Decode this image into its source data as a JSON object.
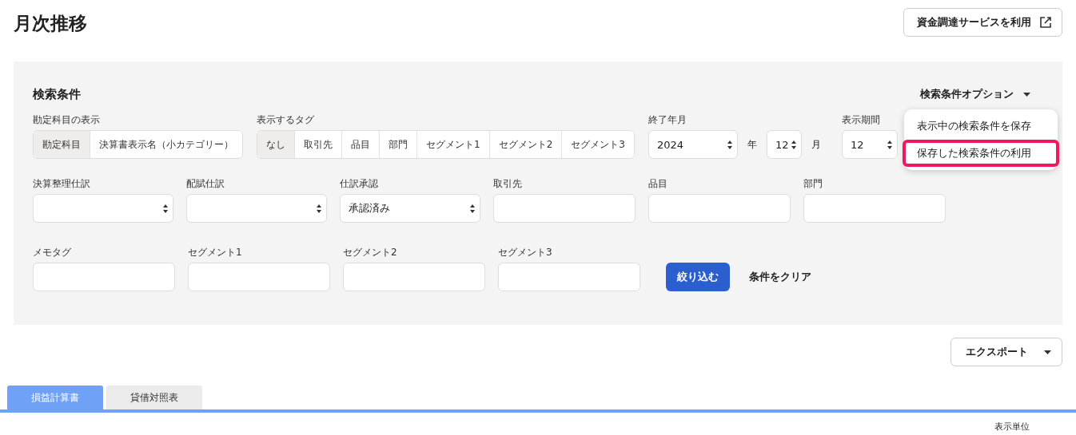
{
  "page": {
    "title": "月次推移",
    "funding_button": "資金調達サービスを利用"
  },
  "search": {
    "title": "検索条件",
    "options_button": "検索条件オプション",
    "options_menu": {
      "expanded": true,
      "items": [
        {
          "label": "表示中の検索条件を保存",
          "highlighted": false
        },
        {
          "label": "保存した検索条件の利用",
          "highlighted": true
        }
      ]
    },
    "account_display": {
      "label": "勘定科目の表示",
      "options": [
        {
          "label": "勘定科目",
          "selected": true
        },
        {
          "label": "決算書表示名（小カテゴリー）",
          "selected": false
        }
      ]
    },
    "tags": {
      "label": "表示するタグ",
      "options": [
        {
          "label": "なし",
          "selected": true
        },
        {
          "label": "取引先",
          "selected": false
        },
        {
          "label": "品目",
          "selected": false
        },
        {
          "label": "部門",
          "selected": false
        },
        {
          "label": "セグメント1",
          "selected": false
        },
        {
          "label": "セグメント2",
          "selected": false
        },
        {
          "label": "セグメント3",
          "selected": false
        }
      ]
    },
    "end_month": {
      "label": "終了年月",
      "year": "2024",
      "year_unit": "年",
      "month": "12",
      "month_unit": "月"
    },
    "period": {
      "label": "表示期間",
      "value": "12"
    },
    "filter_rows": [
      [
        {
          "label": "決算整理仕訳",
          "kind": "select"
        },
        {
          "label": "配賦仕訳",
          "kind": "select"
        },
        {
          "label": "仕訳承認",
          "kind": "select",
          "value": "承認済み"
        },
        {
          "label": "取引先",
          "kind": "input"
        },
        {
          "label": "品目",
          "kind": "input"
        },
        {
          "label": "部門",
          "kind": "input"
        }
      ],
      [
        {
          "label": "メモタグ",
          "kind": "input"
        },
        {
          "label": "セグメント1",
          "kind": "input"
        },
        {
          "label": "セグメント2",
          "kind": "input"
        },
        {
          "label": "セグメント3",
          "kind": "input"
        }
      ]
    ],
    "apply_button": "絞り込む",
    "clear_button": "条件をクリア"
  },
  "export_button": "エクスポート",
  "tabs": [
    {
      "label": "損益計算書",
      "selected": true
    },
    {
      "label": "貸借対照表",
      "selected": false
    }
  ],
  "unit_label": "表示単位"
}
